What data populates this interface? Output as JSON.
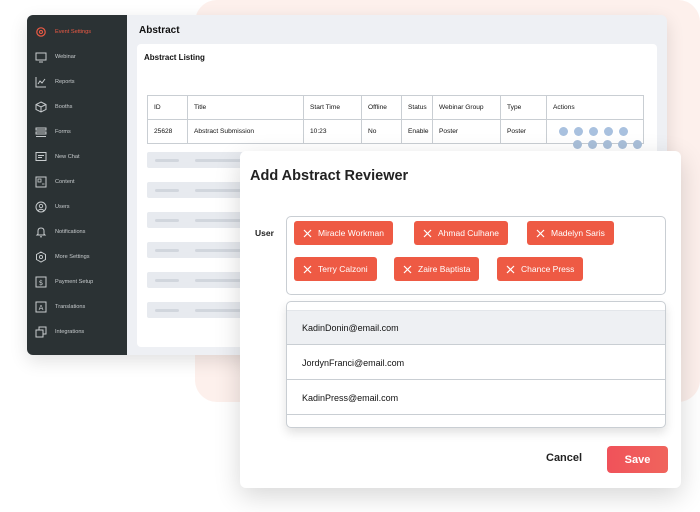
{
  "sidebar": {
    "items": [
      {
        "label": "Event Settings",
        "icon": "gear-icon",
        "active": true
      },
      {
        "label": "Webinar",
        "icon": "monitor-icon"
      },
      {
        "label": "Reports",
        "icon": "chart-icon"
      },
      {
        "label": "Booths",
        "icon": "cube-icon"
      },
      {
        "label": "Forms",
        "icon": "forms-icon"
      },
      {
        "label": "New Chat",
        "icon": "chat-icon"
      },
      {
        "label": "Content",
        "icon": "content-icon"
      },
      {
        "label": "Users",
        "icon": "user-icon"
      },
      {
        "label": "Notifications",
        "icon": "bell-icon"
      },
      {
        "label": "More Settings",
        "icon": "settings-icon"
      },
      {
        "label": "Payment Setup",
        "icon": "dollar-icon"
      },
      {
        "label": "Translations",
        "icon": "translate-icon"
      },
      {
        "label": "Integrations",
        "icon": "integrations-icon"
      }
    ],
    "accent_color": "#ee5a44"
  },
  "main": {
    "title": "Abstract",
    "card_title": "Abstract Listing",
    "table": {
      "headers": [
        "ID",
        "Title",
        "Start Time",
        "Offline",
        "Status",
        "Webinar Group",
        "Type",
        "Actions"
      ],
      "rows": [
        [
          "25628",
          "Abstract Submission",
          "10:23",
          "No",
          "Enable",
          "Poster",
          "Poster"
        ]
      ]
    }
  },
  "modal": {
    "title": "Add Abstract Reviewer",
    "user_label": "User",
    "selected_users": [
      "Miracle Workman",
      "Ahmad Culhane",
      "Madelyn Saris",
      "Terry Calzoni",
      "Zaire Baptista",
      "Chance Press"
    ],
    "dropdown_options": [
      "KadinDonin@email.com",
      "JordynFranci@email.com",
      "KadinPress@email.com"
    ],
    "cancel_label": "Cancel",
    "save_label": "Save",
    "tag_color": "#ee5a44"
  }
}
